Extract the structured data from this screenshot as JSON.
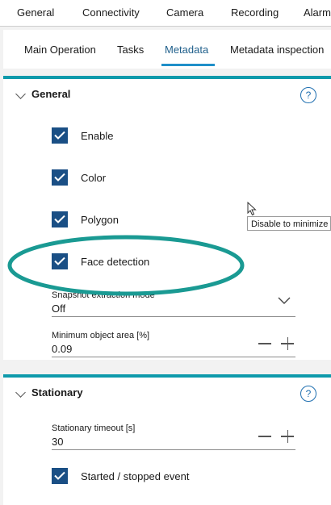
{
  "top_nav": [
    "General",
    "Connectivity",
    "Camera",
    "Recording",
    "Alarm"
  ],
  "sub_tabs": [
    "Main Operation",
    "Tasks",
    "Metadata",
    "Metadata inspection"
  ],
  "active_sub_tab": "Metadata",
  "general": {
    "title": "General",
    "help": "?",
    "checkboxes": [
      {
        "label": "Enable",
        "checked": true
      },
      {
        "label": "Color",
        "checked": true
      },
      {
        "label": "Polygon",
        "checked": true
      },
      {
        "label": "Face detection",
        "checked": true
      }
    ],
    "snapshot": {
      "label": "Snapshot extraction mode",
      "value": "Off"
    },
    "min_area": {
      "label": "Minimum object area [%]",
      "value": "0.09"
    }
  },
  "tooltip": "Disable to minimize",
  "stationary": {
    "title": "Stationary",
    "help": "?",
    "timeout": {
      "label": "Stationary timeout [s]",
      "value": "30"
    },
    "event": {
      "label": "Started / stopped event",
      "checked": true
    }
  },
  "colors": {
    "accent": "#0e9aab",
    "checkbox": "#1a4f85",
    "active_tab": "#1f5f8b",
    "annotation_ellipse": "#1a9a93"
  }
}
